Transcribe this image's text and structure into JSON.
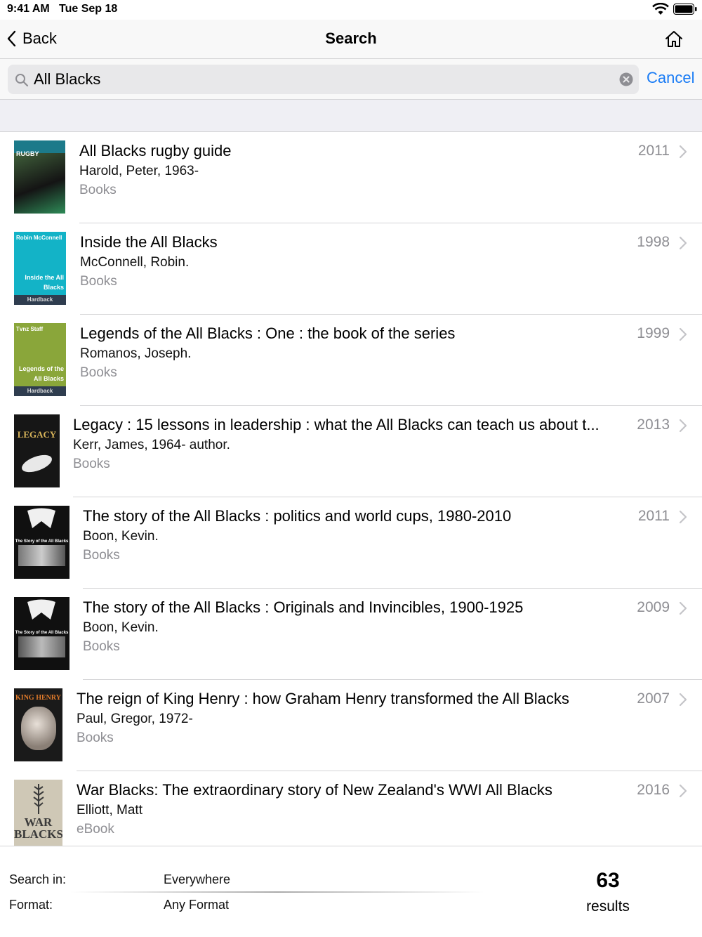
{
  "status_bar": {
    "time": "9:41 AM",
    "date": "Tue Sep 18"
  },
  "nav": {
    "back_label": "Back",
    "title": "Search"
  },
  "search": {
    "query": "All Blacks",
    "cancel_label": "Cancel"
  },
  "results": [
    {
      "title": "All Blacks rugby guide",
      "author": "Harold, Peter, 1963-",
      "format": "Books",
      "year": "2011",
      "cover": {
        "color": "#1c7a8a",
        "accent": "#2e8b57",
        "text_top": "RUGBY"
      }
    },
    {
      "title": "Inside the All Blacks",
      "author": "McConnell, Robin.",
      "format": "Books",
      "year": "1998",
      "cover": {
        "color": "#13b3c7",
        "accent": "#2f3d4f",
        "text_top": "Robin McConnell",
        "text_mid": "Inside the All Blacks",
        "text_band": "Hardback"
      }
    },
    {
      "title": "Legends of the All Blacks : One : the book of the series",
      "author": "Romanos, Joseph.",
      "format": "Books",
      "year": "1999",
      "cover": {
        "color": "#8aa63a",
        "accent": "#2f3d4f",
        "text_top": "Tvnz Staff",
        "text_mid": "Legends of the All Blacks",
        "text_band": "Hardback"
      }
    },
    {
      "title": "Legacy : 15 lessons in leadership : what the All Blacks can teach us about t...",
      "author": "Kerr, James, 1964- author.",
      "format": "Books",
      "year": "2013",
      "cover": {
        "color": "#161616",
        "accent": "#b58b3c",
        "text_top": "LEGACY"
      }
    },
    {
      "title": "The story of the All Blacks : politics and world cups, 1980-2010",
      "author": "Boon, Kevin.",
      "format": "Books",
      "year": "2011",
      "cover": {
        "color": "#101010",
        "accent": "#cccccc",
        "text_top": "The Story of the All Blacks"
      }
    },
    {
      "title": "The story of the All Blacks : Originals and Invincibles, 1900-1925",
      "author": "Boon, Kevin.",
      "format": "Books",
      "year": "2009",
      "cover": {
        "color": "#101010",
        "accent": "#cccccc",
        "text_top": "The Story of the All Blacks"
      }
    },
    {
      "title": "The reign of King Henry : how Graham Henry transformed the All Blacks",
      "author": "Paul, Gregor, 1972-",
      "format": "Books",
      "year": "2007",
      "cover": {
        "color": "#1a1a1a",
        "accent": "#c9a227",
        "text_top": "KING HENRY"
      }
    },
    {
      "title": "War Blacks: The extraordinary story of New Zealand's WWI All Blacks",
      "author": "Elliott, Matt",
      "format": "eBook",
      "year": "2016",
      "cover": {
        "color": "#cfc8b6",
        "accent": "#3a3a3a",
        "text_top": "WAR BLACKS"
      }
    }
  ],
  "footer": {
    "search_in_label": "Search in:",
    "search_in_value": "Everywhere",
    "format_label": "Format:",
    "format_value": "Any Format",
    "count": "63",
    "count_label": "results"
  },
  "colors": {
    "accent": "#1a7cf5",
    "secondary_text": "#8e8e93",
    "separator": "#d4d4d6"
  }
}
